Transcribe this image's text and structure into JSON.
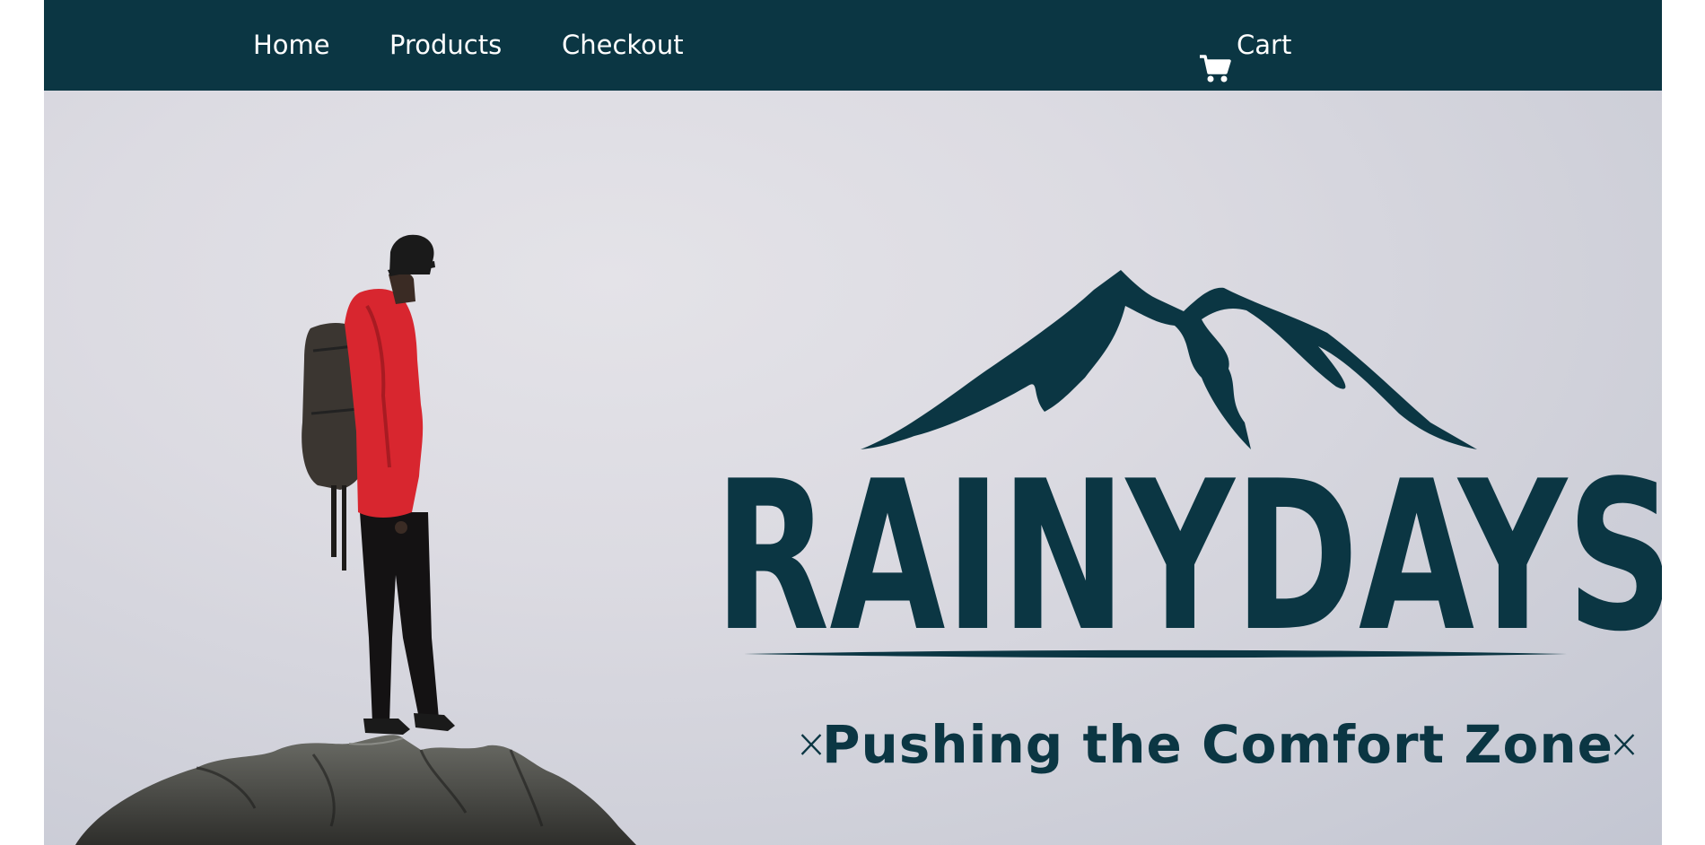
{
  "nav": {
    "home_label": "Home",
    "products_label": "Products",
    "checkout_label": "Checkout",
    "cart_label": "Cart",
    "cart_icon": "shopping-cart-icon",
    "background_color": "#0b3643",
    "text_color": "#ffffff"
  },
  "hero": {
    "brand_name": "RAINYDAYS",
    "tagline": "Pushing the Comfort Zone",
    "logo_color": "#0b3643",
    "jacket_color": "#d8262f"
  }
}
